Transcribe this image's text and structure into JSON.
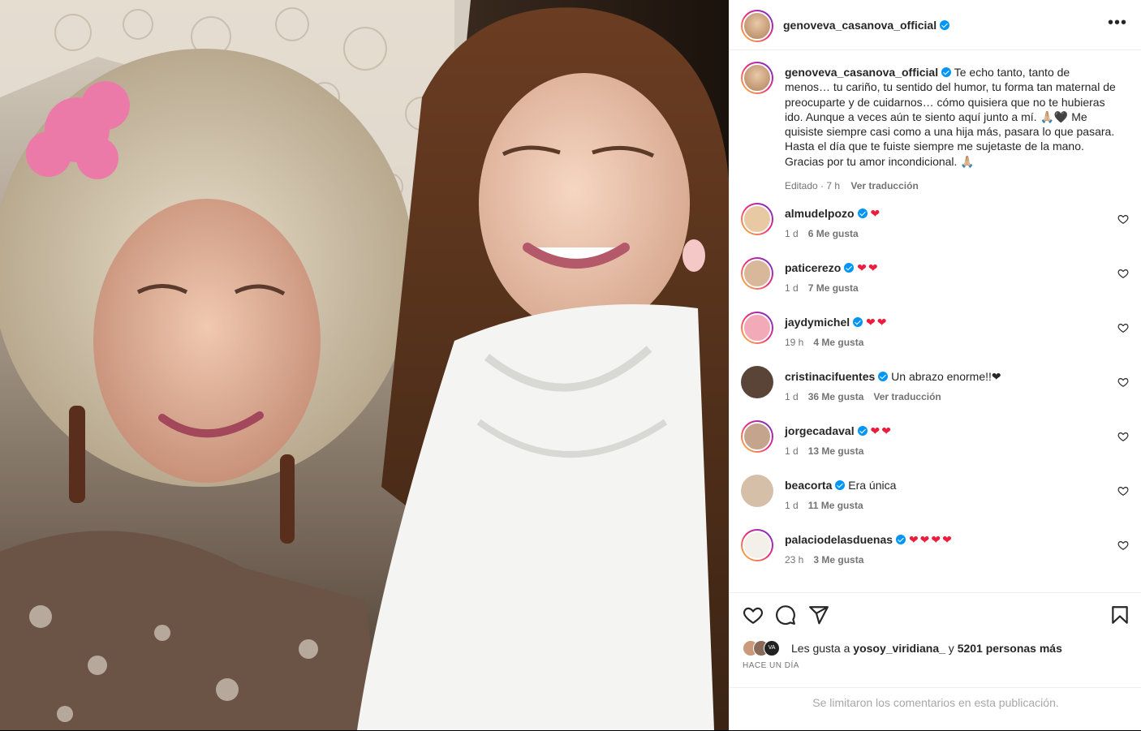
{
  "post": {
    "author": "genoveva_casanova_official",
    "caption": "Te echo tanto, tanto de menos… tu cariño, tu sentido del humor, tu forma tan maternal de preocuparte y de cuidarnos… cómo quisiera que no te hubieras ido. Aunque a veces aún te siento aquí junto a mí. 🙏🏼🖤 Me quisiste siempre casi como a una hija más, pasara lo que pasara. Hasta el día que te fuiste siempre me sujetaste de la mano. Gracias por tu amor incondicional. 🙏🏼",
    "edited_label": "Editado",
    "time": "7 h",
    "translate_label": "Ver traducción",
    "more_label": "•••"
  },
  "comments": [
    {
      "user": "almudelpozo",
      "text": "❤",
      "time": "1 d",
      "likes": "6 Me gusta",
      "translate": ""
    },
    {
      "user": "paticerezo",
      "text": "❤❤",
      "time": "1 d",
      "likes": "7 Me gusta",
      "translate": ""
    },
    {
      "user": "jaydymichel",
      "text": "❤❤",
      "time": "19 h",
      "likes": "4 Me gusta",
      "translate": ""
    },
    {
      "user": "cristinacifuentes",
      "text": "Un abrazo enorme!!❤",
      "time": "1 d",
      "likes": "36 Me gusta",
      "translate": "Ver traducción"
    },
    {
      "user": "jorgecadaval",
      "text": "❤❤",
      "time": "1 d",
      "likes": "13 Me gusta",
      "translate": ""
    },
    {
      "user": "beacorta",
      "text": "Era única",
      "time": "1 d",
      "likes": "11 Me gusta",
      "translate": ""
    },
    {
      "user": "palaciodelasduenas",
      "text": "❤❤❤❤",
      "time": "23 h",
      "likes": "3 Me gusta",
      "translate": ""
    }
  ],
  "likes": {
    "prefix": "Les gusta a",
    "user": "yosoy_viridiana_",
    "connector": "y",
    "others": "5201 personas más"
  },
  "date_label": "HACE UN DÍA",
  "comments_limited": "Se limitaron los comentarios en esta publicación.",
  "icons": {
    "like": "heart-icon",
    "comment": "comment-icon",
    "share": "share-icon",
    "save": "bookmark-icon",
    "verified": "verified-badge-icon"
  },
  "colors": {
    "verified": "#0095f6",
    "heart": "#ed1c3c",
    "muted": "#737373"
  }
}
